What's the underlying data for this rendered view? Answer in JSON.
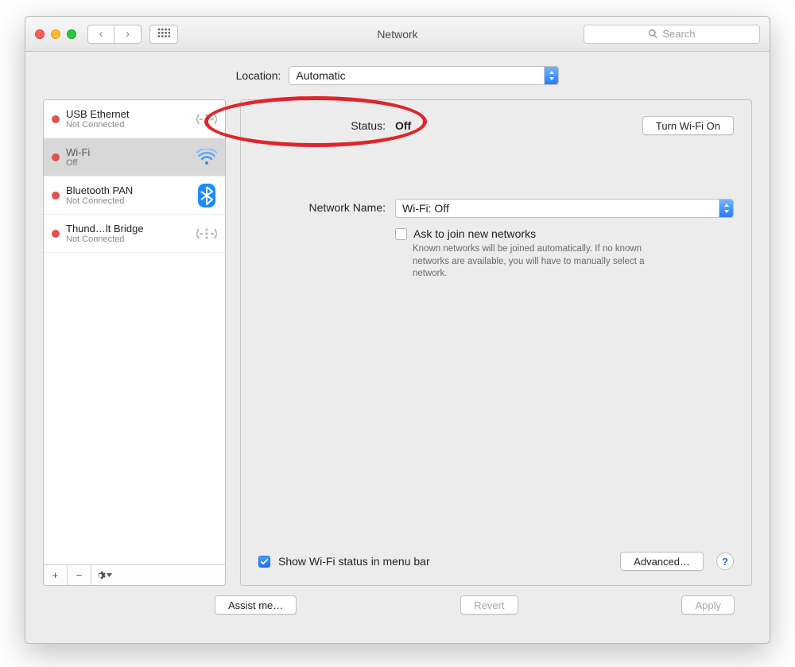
{
  "window": {
    "title": "Network",
    "search_placeholder": "Search"
  },
  "location": {
    "label": "Location:",
    "value": "Automatic"
  },
  "interfaces": [
    {
      "name": "USB Ethernet",
      "status": "Not Connected",
      "icon": "ethernet",
      "selected": false
    },
    {
      "name": "Wi-Fi",
      "status": "Off",
      "icon": "wifi",
      "selected": true
    },
    {
      "name": "Bluetooth PAN",
      "status": "Not Connected",
      "icon": "bluetooth",
      "selected": false
    },
    {
      "name": "Thund…lt Bridge",
      "status": "Not Connected",
      "icon": "ethernet",
      "selected": false
    }
  ],
  "detail": {
    "status_label": "Status:",
    "status_value": "Off",
    "action_button": "Turn Wi-Fi On",
    "network_name_label": "Network Name:",
    "network_name_value": "Wi-Fi: Off",
    "ask_join_label": "Ask to join new networks",
    "ask_join_checked": false,
    "ask_join_help": "Known networks will be joined automatically. If no known networks are available, you will have to manually select a network.",
    "show_menu_label": "Show Wi-Fi status in menu bar",
    "show_menu_checked": true,
    "advanced_button": "Advanced…"
  },
  "footer": {
    "assist": "Assist me…",
    "revert": "Revert",
    "apply": "Apply"
  }
}
